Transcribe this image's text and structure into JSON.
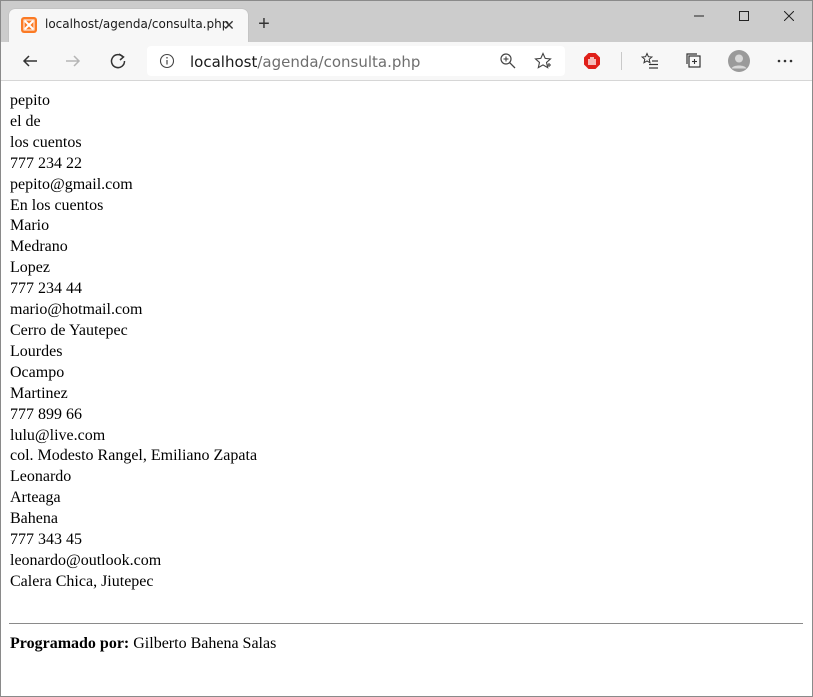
{
  "browser": {
    "tab": {
      "title": "localhost/agenda/consulta.php",
      "favicon": "xampp-icon"
    },
    "address_bar": {
      "url_host": "localhost",
      "url_path": "/agenda/consulta.php"
    }
  },
  "records": [
    "pepito",
    "el de",
    "los cuentos",
    "777 234 22",
    "pepito@gmail.com",
    "En los cuentos",
    "Mario",
    "Medrano",
    "Lopez",
    "777 234 44",
    "mario@hotmail.com",
    "Cerro de Yautepec",
    "Lourdes",
    "Ocampo",
    "Martinez",
    "777 899 66",
    "lulu@live.com",
    "col. Modesto Rangel, Emiliano Zapata",
    "Leonardo",
    "Arteaga",
    "Bahena",
    "777 343 45",
    "leonardo@outlook.com",
    "Calera Chica, Jiutepec"
  ],
  "footer": {
    "label": "Programado por:",
    "author": " Gilberto Bahena Salas"
  },
  "colors": {
    "tab_bar": "#cccccc",
    "toolbar": "#f7f7f7",
    "favicon": "#fb7a24",
    "stop_icon": "#e0201a"
  }
}
